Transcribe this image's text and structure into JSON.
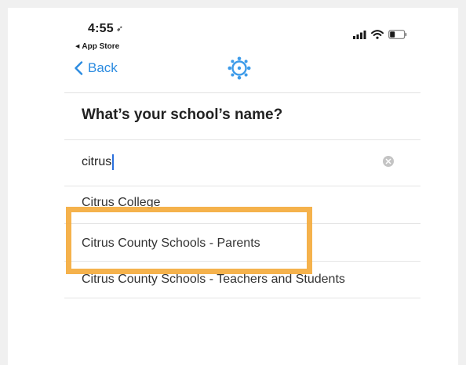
{
  "status_bar": {
    "time": "4:55",
    "location_icon": "location-arrow-icon",
    "back_app_label": "App Store",
    "icons": [
      "signal-icon",
      "wifi-icon",
      "battery-icon"
    ]
  },
  "nav": {
    "back_label": "Back",
    "logo_icon": "app-logo-icon"
  },
  "heading": "What’s your school’s name?",
  "search": {
    "value": "citrus",
    "clear_icon": "clear-icon"
  },
  "results": [
    {
      "label": "Citrus College"
    },
    {
      "label": "Citrus County Schools - Parents"
    },
    {
      "label": "Citrus County Schools - Teachers and Students"
    }
  ],
  "colors": {
    "accent": "#2b8be0",
    "highlight": "#f4aa38",
    "logo": "#3d9be9"
  }
}
